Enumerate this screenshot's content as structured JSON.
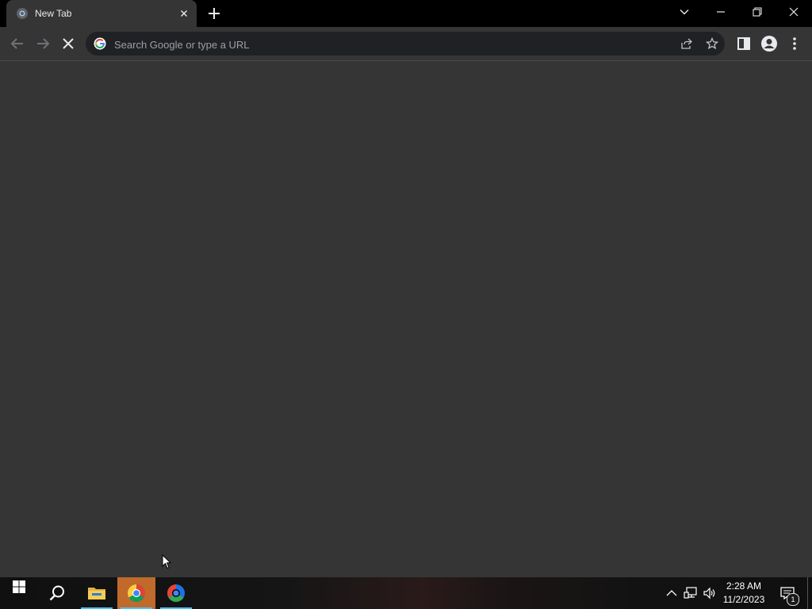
{
  "browser": {
    "tab": {
      "title": "New Tab",
      "favicon": "chrome-loading-icon"
    },
    "omnibox": {
      "placeholder": "Search Google or type a URL",
      "value": ""
    },
    "toolbar_icons": [
      "back-icon",
      "forward-icon",
      "stop-icon",
      "share-icon",
      "star-icon",
      "side-panel-icon",
      "profile-icon",
      "menu-icon"
    ],
    "window_controls": [
      "tab-search-icon",
      "minimize-icon",
      "restore-icon",
      "close-icon"
    ]
  },
  "taskbar": {
    "apps": [
      "windows-start-icon",
      "search-icon",
      "file-explorer-icon",
      "chrome-icon",
      "chrome-beta-icon"
    ],
    "tray_icons": [
      "chevron-up-icon",
      "network-icon",
      "volume-icon"
    ],
    "clock": {
      "time": "2:28 AM",
      "date": "11/2/2023"
    },
    "notifications": {
      "count": "1"
    }
  },
  "colors": {
    "content_bg": "#353535",
    "frame_bg": "#000000",
    "omnibox_bg": "#202124",
    "active_taskbar": "#c06a2b",
    "taskbar_indicator": "#4cc2ff"
  }
}
